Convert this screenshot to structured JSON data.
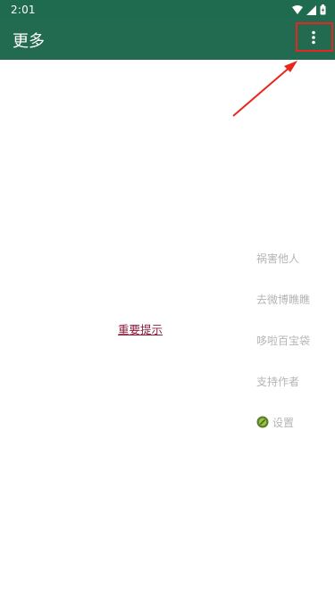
{
  "status_bar": {
    "time": "2:01"
  },
  "app_bar": {
    "title": "更多",
    "overflow_icon": "more-vertical-icon"
  },
  "content": {
    "notice_link": "重要提示",
    "menu_items": [
      {
        "label": "祸害他人"
      },
      {
        "label": "去微博瞧瞧"
      },
      {
        "label": "哆啦百宝袋"
      },
      {
        "label": "支持作者"
      },
      {
        "label": "设置",
        "icon": "settings-emoji-icon"
      }
    ]
  },
  "colors": {
    "app_bar": "#226b51",
    "highlight": "#e8261c",
    "link": "#8b1c3b",
    "menu_text": "#b5b5b5"
  }
}
